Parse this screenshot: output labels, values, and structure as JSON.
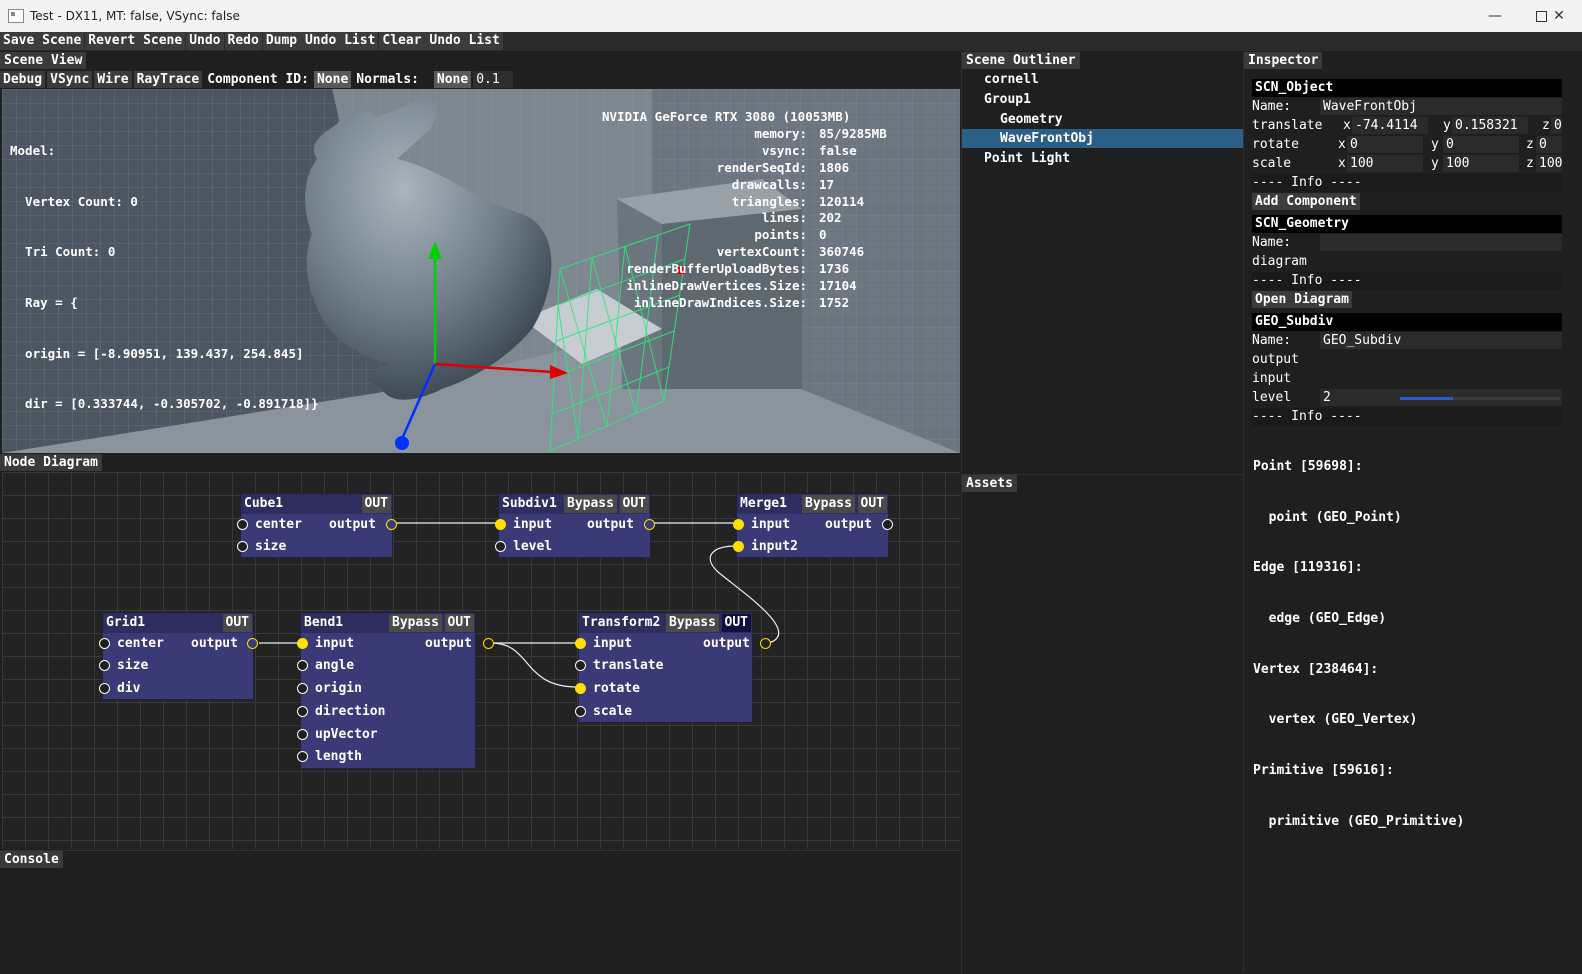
{
  "window": {
    "title": "Test - DX11, MT: false, VSync: false"
  },
  "menubar": [
    "Save Scene",
    "Revert Scene",
    "Undo",
    "Redo",
    "Dump Undo List",
    "Clear Undo List"
  ],
  "scene_view": {
    "header": "Scene View",
    "toolbar": {
      "debug": "Debug",
      "vsync": "VSync",
      "wire": "Wire",
      "raytrace": "RayTrace",
      "component_id_label": "Component ID:",
      "component_id_value": "None",
      "normals_label": "Normals:",
      "normals_value": "None",
      "normals_scale": "0.1"
    },
    "model_info": [
      "Model:",
      "  Vertex Count: 0",
      "  Tri Count: 0",
      "  Ray = {",
      "  origin = [-8.90951, 139.437, 254.845]",
      "  dir = [0.333744, -0.305702, -0.891718]}"
    ],
    "gpu_title": "NVIDIA GeForce RTX 3080 (10053MB)",
    "stats": [
      {
        "k": "memory:",
        "v": "85/9285MB"
      },
      {
        "k": "vsync:",
        "v": "false"
      },
      {
        "k": "renderSeqId:",
        "v": "1806"
      },
      {
        "k": "drawcalls:",
        "v": "17"
      },
      {
        "k": "triangles:",
        "v": "120114"
      },
      {
        "k": "lines:",
        "v": "202"
      },
      {
        "k": "points:",
        "v": "0"
      },
      {
        "k": "vertexCount:",
        "v": "360746"
      },
      {
        "k": "renderBufferUploadBytes:",
        "v": "1736"
      },
      {
        "k": "inlineDrawVertices.Size:",
        "v": "17104"
      },
      {
        "k": "inlineDrawIndices.Size:",
        "v": "1752"
      }
    ]
  },
  "outliner": {
    "header": "Scene Outliner",
    "items": [
      "cornell",
      "Group1",
      "Geometry",
      "WaveFrontObj",
      "Point Light"
    ]
  },
  "assets": {
    "header": "Assets"
  },
  "inspector": {
    "header": "Inspector",
    "obj_title": "SCN_Object",
    "name_label": "Name:",
    "obj_name": "WaveFrontObj",
    "translate_label": "translate",
    "rotate_label": "rotate",
    "scale_label": "scale",
    "x": "x",
    "y": "y",
    "z": "z",
    "translate": [
      "-74.4114",
      "0.158321",
      "0"
    ],
    "rotate": [
      "0",
      "0",
      "0"
    ],
    "scale": [
      "100",
      "100",
      "100"
    ],
    "info": "---- Info ----",
    "add_component": "Add Component",
    "geo_title": "SCN_Geometry",
    "geo_name": "",
    "diagram_label": "diagram",
    "open_diagram": "Open Diagram",
    "subdiv_title": "GEO_Subdiv",
    "subdiv_name": "GEO_Subdiv",
    "output_label": "output",
    "input_label": "input",
    "level_label": "level",
    "level_value": "2",
    "level_fraction": 0.33,
    "info_lines": [
      "Point [59698]:",
      "  point (GEO_Point)",
      "Edge [119316]:",
      "  edge (GEO_Edge)",
      "Vertex [238464]:",
      "  vertex (GEO_Vertex)",
      "Primitive [59616]:",
      "  primitive (GEO_Primitive)"
    ]
  },
  "node_diagram": {
    "header": "Node Diagram",
    "bypass": "Bypass",
    "out": "OUT",
    "nodes": {
      "cube1": {
        "title": "Cube1",
        "inputs": [
          "center",
          "size"
        ],
        "output": "output"
      },
      "subdiv1": {
        "title": "Subdiv1",
        "inputs": [
          "input",
          "level"
        ],
        "output": "output"
      },
      "merge1": {
        "title": "Merge1",
        "inputs": [
          "input",
          "input2"
        ],
        "output": "output"
      },
      "grid1": {
        "title": "Grid1",
        "inputs": [
          "center",
          "size",
          "div"
        ],
        "output": "output"
      },
      "bend1": {
        "title": "Bend1",
        "inputs": [
          "input",
          "angle",
          "origin",
          "direction",
          "upVector",
          "length"
        ],
        "output": "output"
      },
      "transform2": {
        "title": "Transform2",
        "inputs": [
          "input",
          "translate",
          "rotate",
          "scale"
        ],
        "output": "output"
      }
    }
  },
  "console": {
    "header": "Console"
  }
}
